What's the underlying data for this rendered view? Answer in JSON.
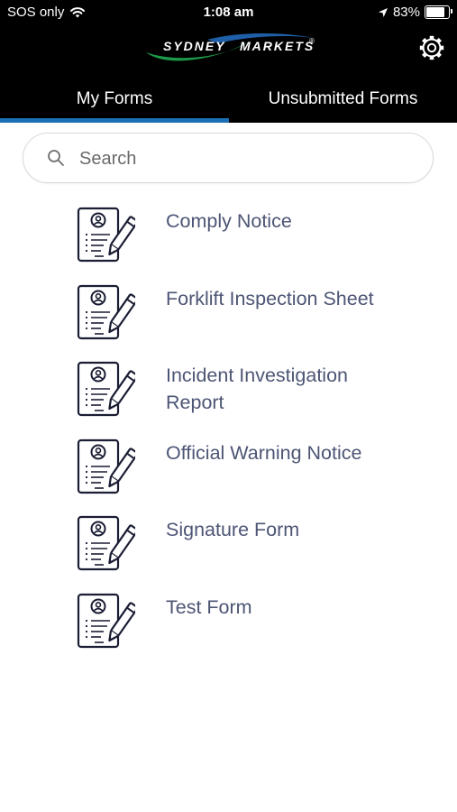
{
  "status_bar": {
    "carrier": "SOS only",
    "time": "1:08 am",
    "battery_percent": "83%",
    "battery_level": 0.83,
    "icons": [
      "wifi-icon",
      "location-arrow-icon",
      "battery-icon"
    ]
  },
  "header": {
    "logo_text_left": "SYDNEY",
    "logo_text_right": "MARKETS",
    "logo_mark": "®",
    "settings_icon": "gear-icon"
  },
  "tabs": [
    {
      "label": "My Forms",
      "active": true
    },
    {
      "label": "Unsubmitted Forms",
      "active": false
    }
  ],
  "search": {
    "placeholder": "Search",
    "value": "",
    "icon": "search-icon"
  },
  "forms": [
    {
      "label": "Comply Notice",
      "icon": "form-document-icon"
    },
    {
      "label": "Forklift Inspection Sheet",
      "icon": "form-document-icon"
    },
    {
      "label": "Incident Investigation Report",
      "icon": "form-document-icon"
    },
    {
      "label": "Official Warning Notice",
      "icon": "form-document-icon"
    },
    {
      "label": "Signature Form",
      "icon": "form-document-icon"
    },
    {
      "label": "Test Form",
      "icon": "form-document-icon"
    }
  ],
  "colors": {
    "header_background": "#000000",
    "tab_indicator": "#1a6fb5",
    "logo_swoosh_green": "#1c9a49",
    "logo_swoosh_blue": "#1f5fa8",
    "form_label_text": "#4d5575",
    "icon_stroke": "#1a1d33"
  }
}
